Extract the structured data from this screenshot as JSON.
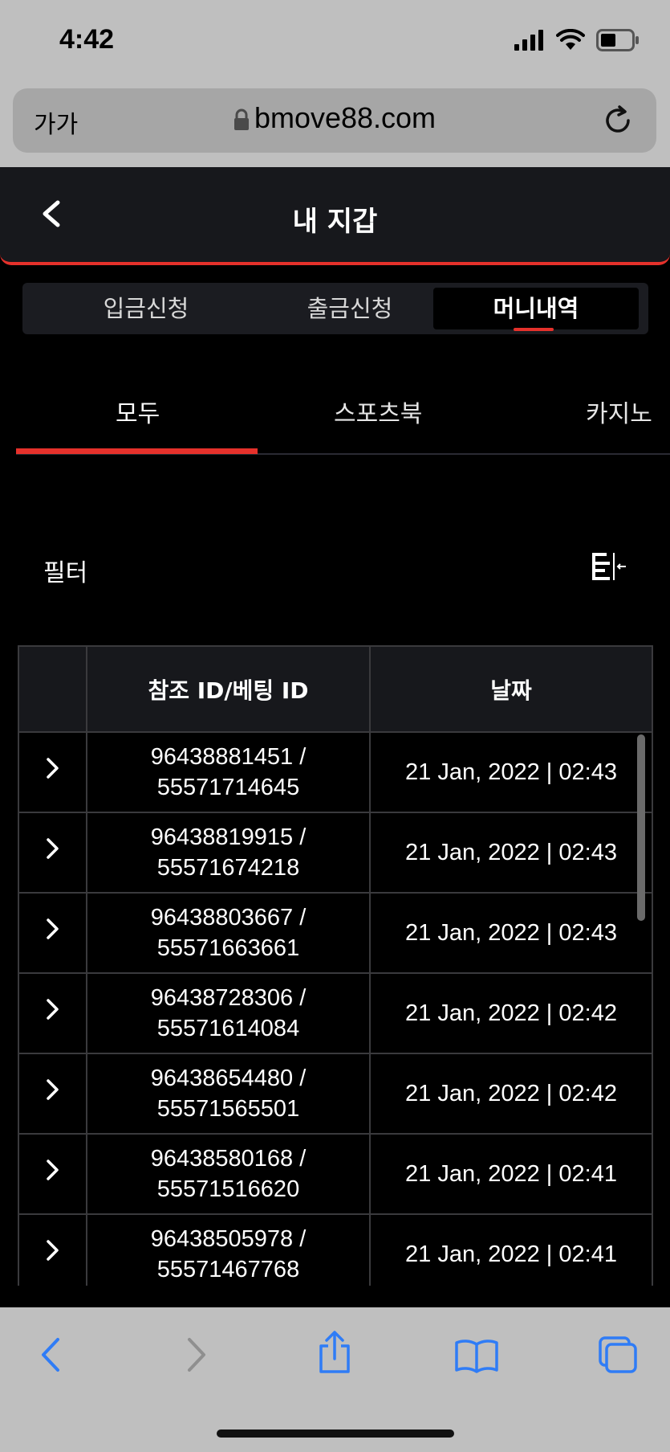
{
  "status_bar": {
    "time": "4:42"
  },
  "browser": {
    "text_size_label": "가가",
    "url": "bmove88.com"
  },
  "header": {
    "title": "내 지갑"
  },
  "segment_tabs": [
    {
      "label": "입금신청"
    },
    {
      "label": "출금신청"
    },
    {
      "label": "머니내역",
      "active": true
    }
  ],
  "category_tabs": [
    {
      "label": "모두",
      "active": true
    },
    {
      "label": "스포츠북"
    },
    {
      "label": "카지노"
    }
  ],
  "filter": {
    "label": "필터"
  },
  "table": {
    "columns": [
      "",
      "참조 ID/베팅 ID",
      "날짜"
    ],
    "rows": [
      {
        "ref_id": "96438881451 /",
        "bet_id": "55571714645",
        "date": "21 Jan, 2022 | 02:43"
      },
      {
        "ref_id": "96438819915 /",
        "bet_id": "55571674218",
        "date": "21 Jan, 2022 | 02:43"
      },
      {
        "ref_id": "96438803667 /",
        "bet_id": "55571663661",
        "date": "21 Jan, 2022 | 02:43"
      },
      {
        "ref_id": "96438728306 /",
        "bet_id": "55571614084",
        "date": "21 Jan, 2022 | 02:42"
      },
      {
        "ref_id": "96438654480 /",
        "bet_id": "55571565501",
        "date": "21 Jan, 2022 | 02:42"
      },
      {
        "ref_id": "96438580168 /",
        "bet_id": "55571516620",
        "date": "21 Jan, 2022 | 02:41"
      },
      {
        "ref_id": "96438505978 /",
        "bet_id": "55571467768",
        "date": "21 Jan, 2022 | 02:41"
      }
    ]
  },
  "colors": {
    "accent": "#e5312b",
    "header_bg": "#17181c",
    "ios_blue": "#2f7cf6"
  }
}
